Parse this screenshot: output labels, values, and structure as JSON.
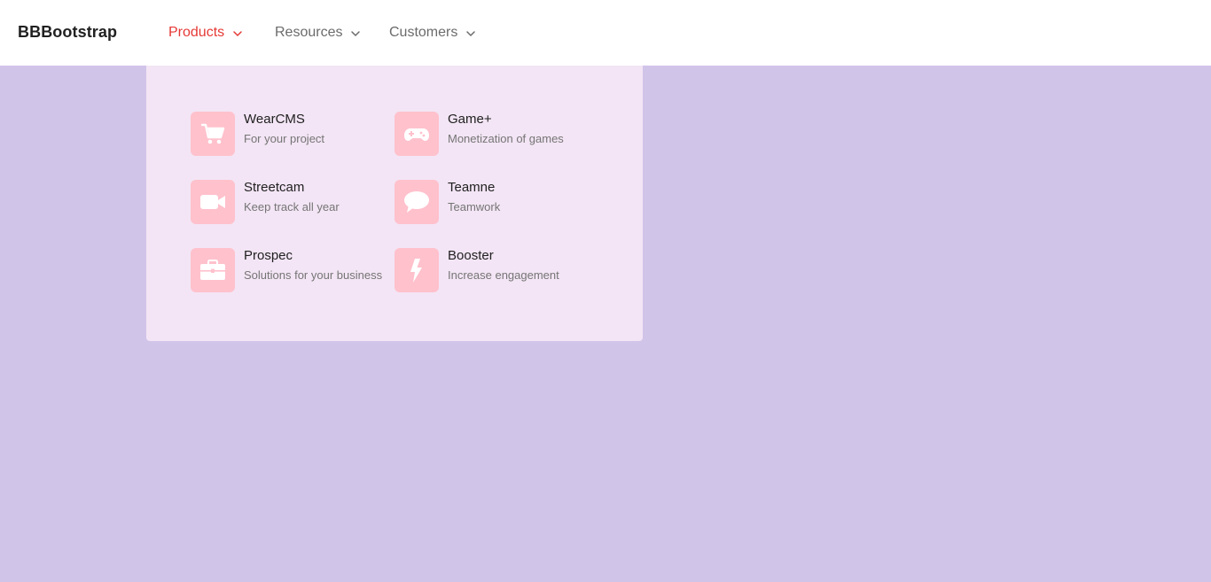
{
  "navbar": {
    "brand": "BBBootstrap",
    "items": [
      {
        "label": "Products",
        "active": true
      },
      {
        "label": "Resources",
        "active": false
      },
      {
        "label": "Customers",
        "active": false
      }
    ]
  },
  "dropdown": {
    "items": [
      {
        "title": "WearCMS",
        "subtitle": "For your project",
        "icon": "cart-icon"
      },
      {
        "title": "Game+",
        "subtitle": "Monetization of games",
        "icon": "gamepad-icon"
      },
      {
        "title": "Streetcam",
        "subtitle": "Keep track all year",
        "icon": "video-camera-icon"
      },
      {
        "title": "Teamne",
        "subtitle": "Teamwork",
        "icon": "chat-bubble-icon"
      },
      {
        "title": "Prospec",
        "subtitle": "Solutions for your business",
        "icon": "briefcase-icon"
      },
      {
        "title": "Booster",
        "subtitle": "Increase engagement",
        "icon": "bolt-icon"
      }
    ]
  },
  "colors": {
    "background": "#d1c4e9",
    "dropdown_bg": "#f3e5f5",
    "icon_tile": "#ffc1cc",
    "active_nav": "#e53935",
    "nav_text": "#6b6b6b"
  }
}
